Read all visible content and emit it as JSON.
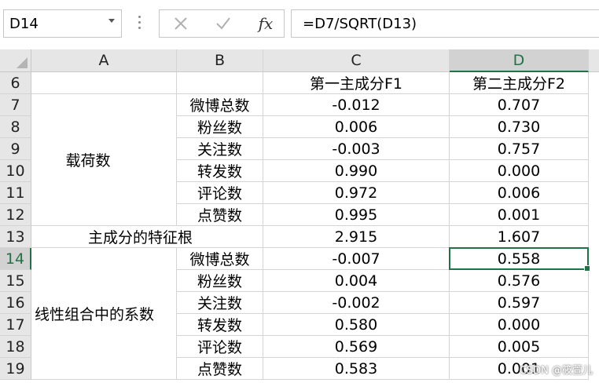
{
  "name_box": {
    "value": "D14"
  },
  "formula_bar": {
    "cancel_icon": "close-x-icon",
    "enter_icon": "checkmark-icon",
    "fx_label": "fx",
    "formula": "=D7/SQRT(D13)"
  },
  "columns": [
    "A",
    "B",
    "C",
    "D"
  ],
  "rows": [
    "6",
    "7",
    "8",
    "9",
    "10",
    "11",
    "12",
    "13",
    "14",
    "15",
    "16",
    "17",
    "18",
    "19"
  ],
  "cells": {
    "C6": "第一主成分F1",
    "D6": "第二主成分F2",
    "A_loading": "载荷数",
    "B7": "微博总数",
    "C7": "-0.012",
    "D7": "0.707",
    "B8": "粉丝数",
    "C8": "0.006",
    "D8": "0.730",
    "B9": "关注数",
    "C9": "-0.003",
    "D9": "0.757",
    "B10": "转发数",
    "C10": "0.990",
    "D10": "0.000",
    "B11": "评论数",
    "C11": "0.972",
    "D11": "0.006",
    "B12": "点赞数",
    "C12": "0.995",
    "D12": "0.001",
    "A13": "主成分的特征根",
    "C13": "2.915",
    "D13": "1.607",
    "A_coef": "线性组合中的系数",
    "B14": "微博总数",
    "C14": "-0.007",
    "D14": "0.558",
    "B15": "粉丝数",
    "C15": "0.004",
    "D15": "0.576",
    "B16": "关注数",
    "C16": "-0.002",
    "D16": "0.597",
    "B17": "转发数",
    "C17": "0.580",
    "D17": "0.000",
    "B18": "评论数",
    "C18": "0.569",
    "D18": "0.005",
    "B19": "点赞数",
    "C19": "0.583",
    "D19": "0.001"
  },
  "selected_cell": "D14",
  "watermark": "CSDN @筱萱儿",
  "colors": {
    "accent": "#217346",
    "header_bg": "#e6e6e6",
    "gridline": "#d4d4d4"
  }
}
